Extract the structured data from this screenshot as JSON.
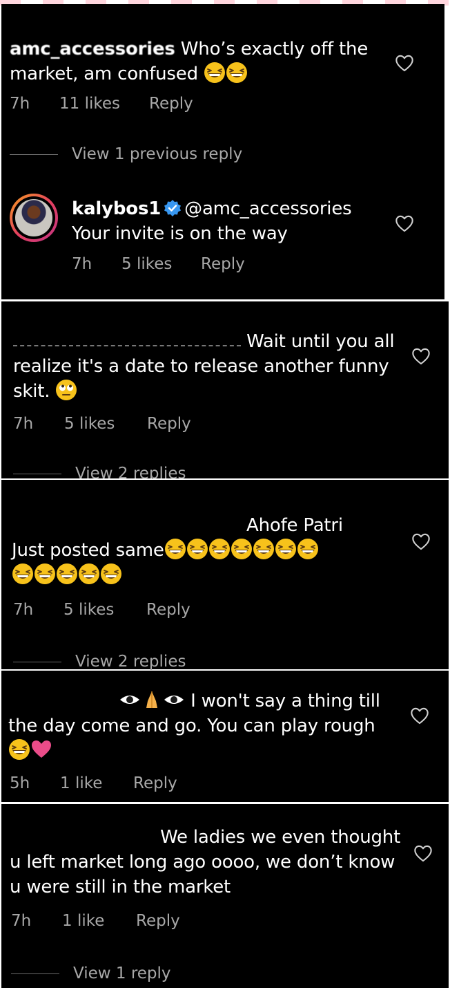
{
  "comments": [
    {
      "username": "amc_accessories",
      "text": " Who’s exactly off the market, am confused",
      "time": "7h",
      "likes": "11 likes",
      "reply": "Reply",
      "view_replies": "View 1 previous reply"
    },
    {
      "username": "kalybos1",
      "mention": "@amc_accessories",
      "text": "Your invite is on the way",
      "time": "7h",
      "likes": "5 likes",
      "reply": "Reply"
    },
    {
      "username": "",
      "text": " Wait until you all realize it's a date to release another funny skit.",
      "time": "7h",
      "likes": "5 likes",
      "reply": "Reply",
      "view_replies": "View 2 replies"
    },
    {
      "username": "",
      "text": "Ahofe Patri",
      "text2": "Just posted same",
      "time": "7h",
      "likes": "5 likes",
      "reply": "Reply",
      "view_replies": "View 2 replies"
    },
    {
      "username": "",
      "text": " I won't say a thing till the day come and go. You can play rough",
      "time": "5h",
      "likes": "1 like",
      "reply": "Reply"
    },
    {
      "username": "",
      "text": " We ladies we even thought u left market long ago oooo, we don’t know u were still in the market",
      "time": "7h",
      "likes": "1 like",
      "reply": "Reply",
      "view_replies": "View 1 reply"
    }
  ],
  "icons": {
    "heart": "heart-outline-icon",
    "verified": "verified-badge-icon",
    "laugh": "grinning-squinting-face-emoji",
    "eye_roll": "face-with-rolling-eyes-emoji",
    "eye": "eye-emoji",
    "pray": "folded-hands-emoji",
    "pink_heart": "pink-heart-emoji"
  },
  "colors": {
    "background": "#000000",
    "text": "#ffffff",
    "meta": "#a8a8a8",
    "link": "#e0f1ff",
    "verified": "#3897f0"
  }
}
